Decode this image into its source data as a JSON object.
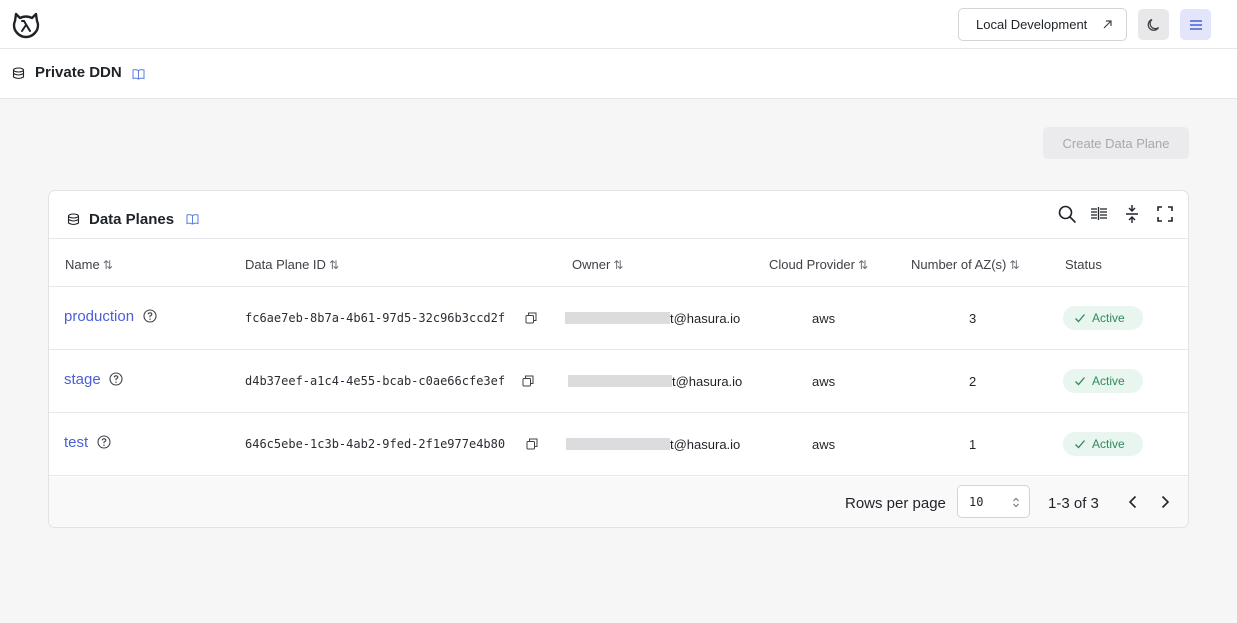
{
  "topbar": {
    "logo_icon": "hasura-logo-icon",
    "local_dev_label": "Local Development",
    "external_icon": "external-link-icon",
    "theme_icon": "moon-icon",
    "menu_icon": "hamburger-menu-icon"
  },
  "subheader": {
    "title": "Private DDN",
    "icon": "database-icon",
    "docs_icon": "book-icon"
  },
  "actions": {
    "create_label": "Create Data Plane"
  },
  "card": {
    "title": "Data Planes",
    "icon": "database-icon",
    "docs_icon": "book-icon",
    "toolbar_icons": [
      "search-icon",
      "columns-icon",
      "density-icon",
      "fullscreen-icon"
    ]
  },
  "table": {
    "columns": [
      {
        "label": "Name",
        "sort": "⇅"
      },
      {
        "label": "Data Plane ID",
        "sort": "⇅"
      },
      {
        "label": "Owner",
        "sort": "⇅"
      },
      {
        "label": "Cloud Provider",
        "sort": "⇅"
      },
      {
        "label": "Number of AZ(s)",
        "sort": "⇅"
      },
      {
        "label": "Status"
      }
    ],
    "rows": [
      {
        "name": "production",
        "id": "fc6ae7eb-8b7a-4b61-97d5-32c96b3ccd2f",
        "owner_suffix": "t@hasura.io",
        "provider": "aws",
        "azs": "3",
        "status": "Active"
      },
      {
        "name": "stage",
        "id": "d4b37eef-a1c4-4e55-bcab-c0ae66cfe3ef",
        "owner_suffix": "t@hasura.io",
        "provider": "aws",
        "azs": "2",
        "status": "Active"
      },
      {
        "name": "test",
        "id": "646c5ebe-1c3b-4ab2-9fed-2f1e977e4b80",
        "owner_suffix": "t@hasura.io",
        "provider": "aws",
        "azs": "1",
        "status": "Active"
      }
    ]
  },
  "pagination": {
    "rows_per_page_label": "Rows per page",
    "rows_per_page_value": "10",
    "range": "1-3 of 3"
  },
  "colors": {
    "link": "#4b5fd6",
    "active_bg": "#e9f5ef",
    "active_fg": "#2e8b5b"
  }
}
